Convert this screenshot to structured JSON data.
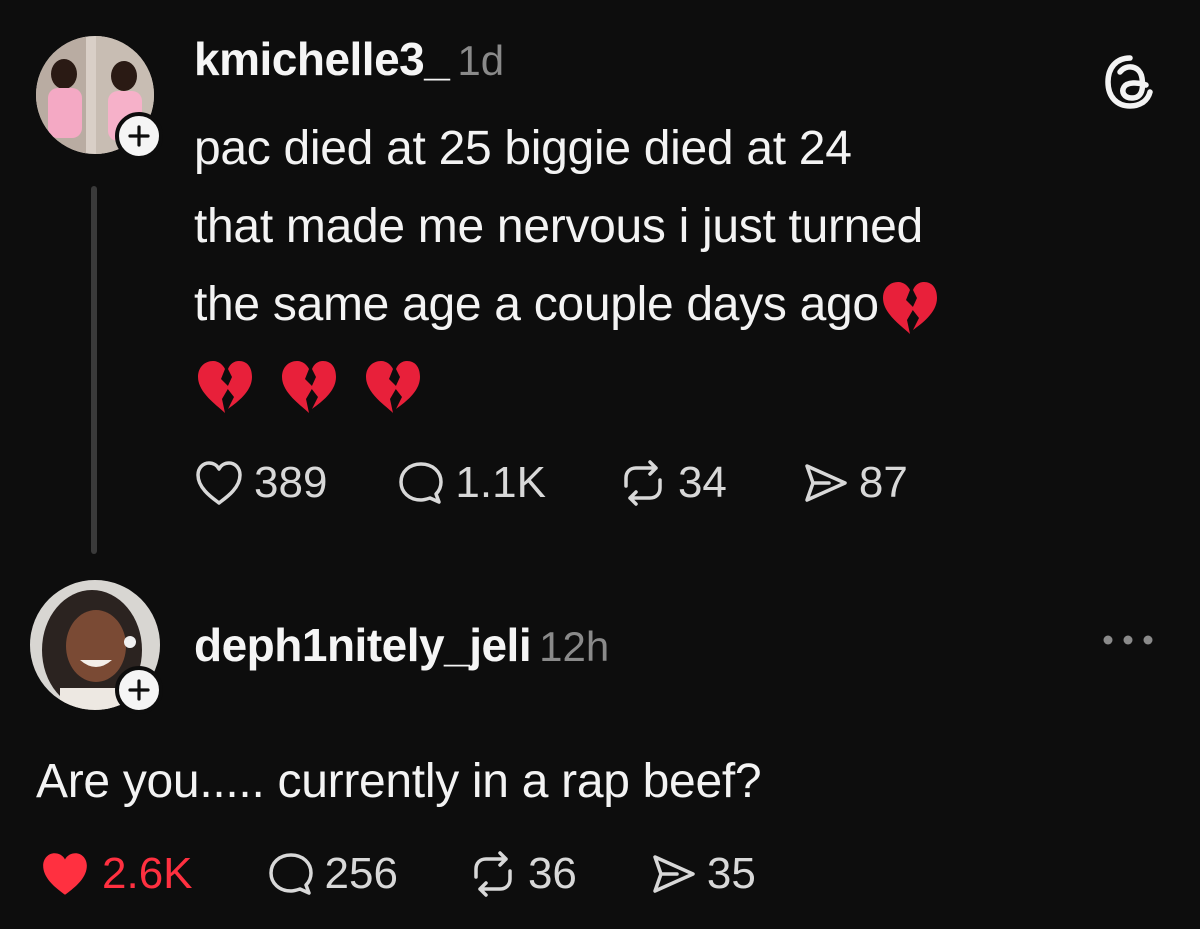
{
  "post": {
    "username": "kmichelle3_",
    "time": "1d",
    "lines": [
      "pac died at 25 biggie died at 24",
      "that made me nervous i just turned",
      "the same age a couple days ago"
    ],
    "emoji_name": "broken-heart",
    "actions": {
      "likes": "389",
      "replies": "1.1K",
      "reposts": "34",
      "shares": "87"
    }
  },
  "reply": {
    "username": "deph1nitely_jeli",
    "time": "12h",
    "text": "Are you..... currently in a rap beef?",
    "actions": {
      "likes": "2.6K",
      "replies": "256",
      "reposts": "36",
      "shares": "35"
    }
  },
  "colors": {
    "background": "#0d0d0d",
    "liked": "#ff3040",
    "muted": "#8a8a8a",
    "broken_heart": "#e8203a"
  }
}
